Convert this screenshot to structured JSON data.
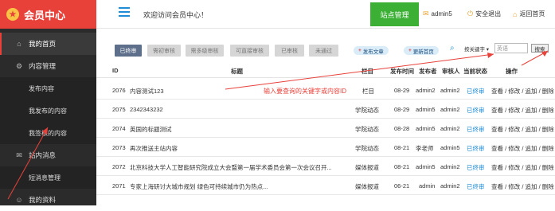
{
  "sidebar": {
    "brand": "会员中心",
    "logo_glyph": "★",
    "items": [
      {
        "label": "我的首页",
        "icon": "home-icon",
        "glyph": "⌂"
      },
      {
        "label": "内容管理",
        "icon": "gear-icon",
        "glyph": "⚙"
      },
      {
        "label": "发布内容"
      },
      {
        "label": "我发布的内容"
      },
      {
        "label": "我签核的内容"
      },
      {
        "label": "站内消息",
        "icon": "message-icon",
        "glyph": "✉"
      },
      {
        "label": "短消息管理"
      },
      {
        "label": "我的资料",
        "icon": "user-icon",
        "glyph": "☺"
      }
    ]
  },
  "header": {
    "welcome": "欢迎访问会员中心！",
    "manage_button": "站点管理",
    "user": "admin5",
    "logout": "安全退出",
    "back_home": "返回首页"
  },
  "toolbar": {
    "filters": [
      "已终审",
      "需初审核",
      "需多级审核",
      "可直接审核",
      "已审核",
      "未通过"
    ],
    "publish": "发布文章",
    "update_home": "更新首页",
    "keyword_select": "按关键字",
    "keyword_value": "英语",
    "search_button": "搜索"
  },
  "table": {
    "headers": [
      "ID",
      "标题",
      "栏目",
      "发布时间",
      "发布者",
      "审核人",
      "当前状态",
      "操作"
    ],
    "rows": [
      {
        "id": "2076",
        "title": "内容测试123",
        "column": "栏目",
        "date": "08-29",
        "publisher": "admin2",
        "reviewer": "admin2",
        "status": "已终审",
        "ops": "查看 / 修改 / 追加 / 删除"
      },
      {
        "id": "2075",
        "title": "2342343232",
        "column": "学院动态",
        "date": "08-29",
        "publisher": "admin5",
        "reviewer": "admin2",
        "status": "已终审",
        "ops": "查看 / 修改 / 追加 / 删除"
      },
      {
        "id": "2074",
        "title": "英国的标题测试",
        "column": "学院动态",
        "date": "08-28",
        "publisher": "admin5",
        "reviewer": "admin2",
        "status": "已终审",
        "ops": "查看 / 修改 / 追加 / 删除"
      },
      {
        "id": "2073",
        "title": "再次推送主站内容",
        "column": "学院动态",
        "date": "08-21",
        "publisher": "李老师",
        "reviewer": "admin5",
        "status": "已终审",
        "ops": "查看 / 修改 / 追加 / 删除"
      },
      {
        "id": "2072",
        "title": "北京科技大学人工智能研究院成立大会暨第一届学术委员会第一次会议召开...",
        "column": "媒体报道",
        "date": "08-21",
        "publisher": "admin5",
        "reviewer": "admin2",
        "status": "已终审",
        "ops": "查看 / 修改 / 追加 / 删除"
      },
      {
        "id": "2071",
        "title": "专家上海研讨大城市规划 绿色可持续城市仍为热点...",
        "column": "媒体报道",
        "date": "06-21",
        "publisher": "admin",
        "reviewer": "admin2",
        "status": "已终审",
        "ops": "查看 / 修改 / 追加 / 删除"
      }
    ]
  },
  "annotation": "输入要查询的关键字或内容ID",
  "colors": {
    "brand_red": "#e8413a",
    "sidebar_bg": "#2b2b2b",
    "manage_green": "#3cb035",
    "status_blue": "#1e8cd6"
  }
}
